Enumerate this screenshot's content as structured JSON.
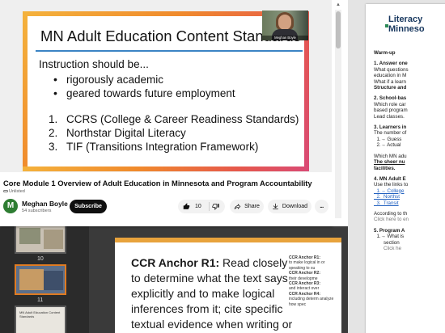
{
  "video": {
    "slide_title": "MN Adult Education Content Standards",
    "intro": "Instruction should be...",
    "bullets": [
      "rigorously academic",
      "geared towards future employment"
    ],
    "numbered": [
      {
        "num": "1.",
        "text": "CCRS (College & Career Readiness Standards)"
      },
      {
        "num": "2.",
        "text": "Northstar Digital Literacy"
      },
      {
        "num": "3.",
        "text": "TIF (Transitions Integration Framework)"
      }
    ],
    "webcam_name": "Meghan Boyle",
    "title": "Core Module 1 Overview of Adult Education in Minnesota and Program Accountability",
    "visibility": "Unlisted"
  },
  "channel": {
    "initial": "M",
    "name": "Meghan Boyle",
    "subscribers": "54 subscribers",
    "subscribe_label": "Subscribe"
  },
  "actions": {
    "like_count": "10",
    "share_label": "Share",
    "download_label": "Download",
    "more_label": "..."
  },
  "presentation": {
    "thumbnails": [
      {
        "title": "",
        "number": "10"
      },
      {
        "title": "",
        "number": "11"
      },
      {
        "title": "MN Adult Education Content Standards",
        "number": ""
      }
    ],
    "slide_label": "CCR Anchor R1:",
    "slide_text": "Read closely to determine what the text says explicitly and  to make logical inferences from it; cite specific textual evidence when writing  or",
    "side_notes": [
      {
        "label": "CCR Anchor R1:",
        "text": "to make logical in or speaking to su"
      },
      {
        "label": "CCR Anchor R2:",
        "text": "their developme"
      },
      {
        "label": "CCR Anchor R3:",
        "text": "and interact over"
      },
      {
        "label": "CCR Anchor R4:",
        "text": "including determ analyze how spec"
      }
    ]
  },
  "document": {
    "logo_lines": [
      "Literacy",
      "Minneso"
    ],
    "lines": [
      {
        "text": "Warm-up",
        "style": "b"
      },
      {
        "text": "",
        "style": "gap"
      },
      {
        "text": "1. Answer one",
        "style": "b"
      },
      {
        "text": "What questions",
        "style": ""
      },
      {
        "text": "education in M",
        "style": ""
      },
      {
        "text": "What if a learn",
        "style": ""
      },
      {
        "text": "Structure and",
        "style": "b"
      },
      {
        "text": "",
        "style": "gap"
      },
      {
        "text": "2. School-bas",
        "style": "b"
      },
      {
        "text": "Which role car",
        "style": ""
      },
      {
        "text": "based program",
        "style": ""
      },
      {
        "text": "Lead classes.",
        "style": ""
      },
      {
        "text": "",
        "style": "gap"
      },
      {
        "text": "3. Learners in",
        "style": "b"
      },
      {
        "text": "The number of",
        "style": ""
      },
      {
        "text": "  1.→ Guess",
        "style": ""
      },
      {
        "text": "  2.→ Actual",
        "style": ""
      },
      {
        "text": "",
        "style": "gap"
      },
      {
        "text": "Which MN adu",
        "style": ""
      },
      {
        "text": "The sheer nu",
        "style": "u"
      },
      {
        "text": "facilities.",
        "style": "b"
      },
      {
        "text": "",
        "style": "gap"
      },
      {
        "text": "4. MN Adult E",
        "style": "b"
      },
      {
        "text": "Use the links to",
        "style": ""
      },
      {
        "text": "  1.→ College",
        "style": "link"
      },
      {
        "text": "  2.  Northst",
        "style": "link"
      },
      {
        "text": "  3.  Transit",
        "style": "link"
      },
      {
        "text": "",
        "style": "gap"
      },
      {
        "text": "According to th",
        "style": ""
      },
      {
        "text": "Click here to en",
        "style": "gray"
      },
      {
        "text": "",
        "style": "gap"
      },
      {
        "text": "5. Program A",
        "style": "b"
      },
      {
        "text": "  1.→ What is",
        "style": ""
      },
      {
        "text": "       section",
        "style": ""
      },
      {
        "text": "       Click he",
        "style": "gray"
      }
    ]
  }
}
